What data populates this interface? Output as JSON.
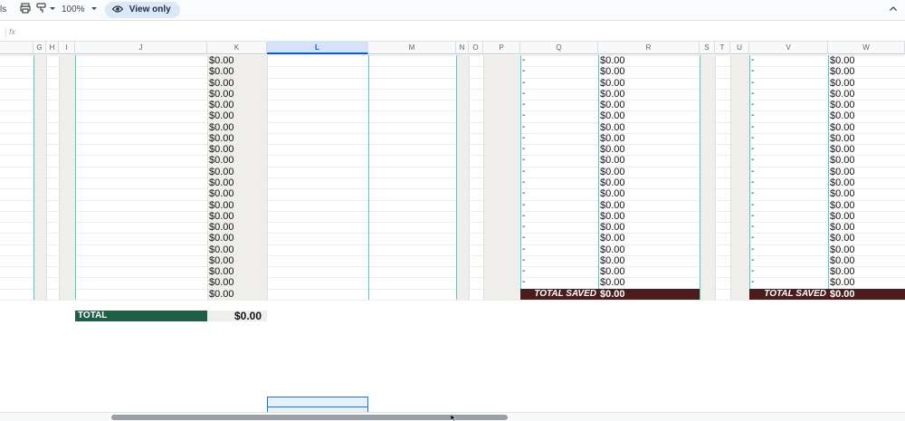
{
  "toolbar": {
    "cut_label": "ls",
    "zoom_label": "100%",
    "view_only_label": "View only",
    "icons": [
      "print-icon",
      "paint-format-icon",
      "chevron-down-icon",
      "eye-icon",
      "chevron-up-icon"
    ]
  },
  "formula_bar": {
    "fx_label": "fx",
    "value": ""
  },
  "columns": [
    "G",
    "H",
    "I",
    "J",
    "K",
    "L",
    "M",
    "N",
    "O",
    "P",
    "Q",
    "R",
    "S",
    "T",
    "U",
    "V",
    "W"
  ],
  "selected_column": "L",
  "k_column_values": [
    "$0.00",
    "$0.00",
    "$0.00",
    "$0.00",
    "$0.00",
    "$0.00",
    "$0.00",
    "$0.00",
    "$0.00",
    "$0.00",
    "$0.00",
    "$0.00",
    "$0.00",
    "$0.00",
    "$0.00",
    "$0.00",
    "$0.00",
    "$0.00",
    "$0.00",
    "$0.00",
    "$0.00",
    "$0.00"
  ],
  "q_column_values": [
    "-",
    "-",
    "-",
    "-",
    "-",
    "-",
    "-",
    "-",
    "-",
    "-",
    "-",
    "-",
    "-",
    "-",
    "-",
    "-",
    "-",
    "-",
    "-",
    "-",
    "-"
  ],
  "r_column_values": [
    "$0.00",
    "$0.00",
    "$0.00",
    "$0.00",
    "$0.00",
    "$0.00",
    "$0.00",
    "$0.00",
    "$0.00",
    "$0.00",
    "$0.00",
    "$0.00",
    "$0.00",
    "$0.00",
    "$0.00",
    "$0.00",
    "$0.00",
    "$0.00",
    "$0.00",
    "$0.00",
    "$0.00"
  ],
  "v_column_values": [
    "-",
    "-",
    "-",
    "-",
    "-",
    "-",
    "-",
    "-",
    "-",
    "-",
    "-",
    "-",
    "-",
    "-",
    "-",
    "-",
    "-",
    "-",
    "-",
    "-",
    "-"
  ],
  "w_column_values": [
    "$0.00",
    "$0.00",
    "$0.00",
    "$0.00",
    "$0.00",
    "$0.00",
    "$0.00",
    "$0.00",
    "$0.00",
    "$0.00",
    "$0.00",
    "$0.00",
    "$0.00",
    "$0.00",
    "$0.00",
    "$0.00",
    "$0.00",
    "$0.00",
    "$0.00",
    "$0.00",
    "$0.00"
  ],
  "total_saved_1": {
    "label": "TOTAL SAVED",
    "value": "$0.00"
  },
  "total_saved_2": {
    "label": "TOTAL SAVED",
    "value": "$0.00"
  },
  "total": {
    "label": "TOTAL",
    "value": "$0.00"
  },
  "colors": {
    "total_green": "#1e5f45",
    "total_saved_maroon": "#4a1c1e",
    "cyan_border": "#4dd0c4",
    "band_beige": "#efeeea"
  }
}
